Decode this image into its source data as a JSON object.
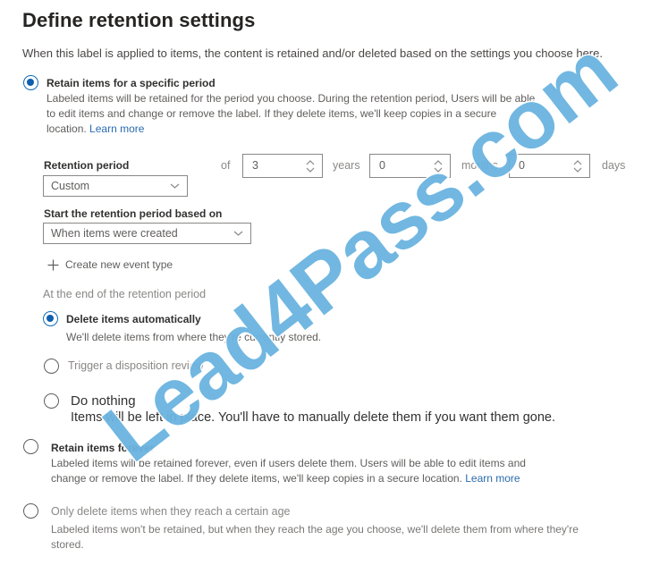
{
  "header": {
    "title": "Define retention settings",
    "intro": "When this label is applied to items, the content is retained and/or deleted based on the settings you choose here."
  },
  "retain_period": {
    "title": "Retain items for a specific period",
    "desc_line1": "Labeled items will be retained for the period you choose. During the retention period, Users will be able",
    "desc_line2": "to edit items and change or remove the label. If they delete items, we'll keep copies in a secure",
    "desc_line3": "location.",
    "learn_more": "Learn more",
    "checked": true
  },
  "retention_period": {
    "label": "Retention period",
    "of_label": "of",
    "dropdown_value": "Custom",
    "years": {
      "value": "3",
      "unit": "years"
    },
    "months": {
      "value": "0",
      "unit": "months"
    },
    "days": {
      "value": "0",
      "unit": "days"
    }
  },
  "start_based_on": {
    "label": "Start the retention period based on",
    "dropdown_value": "When items were created",
    "create_event_label": "Create new event type"
  },
  "end_of_period": {
    "label": "At the end of the retention period",
    "options": [
      {
        "title": "Delete items automatically",
        "desc": "We'll delete items from where they're currently stored.",
        "checked": true
      },
      {
        "title": "Trigger a disposition review",
        "desc": "",
        "checked": false
      },
      {
        "title": "Do nothing",
        "desc": "Items will be left in place. You'll have to manually delete them if you want them gone.",
        "checked": false
      }
    ]
  },
  "retain_forever": {
    "title": "Retain items forever",
    "desc_line1": "Labeled items will be retained forever, even if users delete them. Users will be able to edit items and",
    "desc_line2": "change or remove the label. If they delete items, we'll keep copies in a secure location.",
    "learn_more": "Learn more",
    "checked": false
  },
  "delete_only": {
    "title": "Only delete items when they reach a certain age",
    "desc_line1": "Labeled items won't be retained, but when they reach the age you choose, we'll delete them from where  they're",
    "desc_line2": "stored.",
    "checked": false
  },
  "watermark": {
    "text": "Lead4Pass.com",
    "color": "#6ab4e0"
  },
  "colors": {
    "accent": "#0f6cbd",
    "link": "#2b6cb0"
  }
}
